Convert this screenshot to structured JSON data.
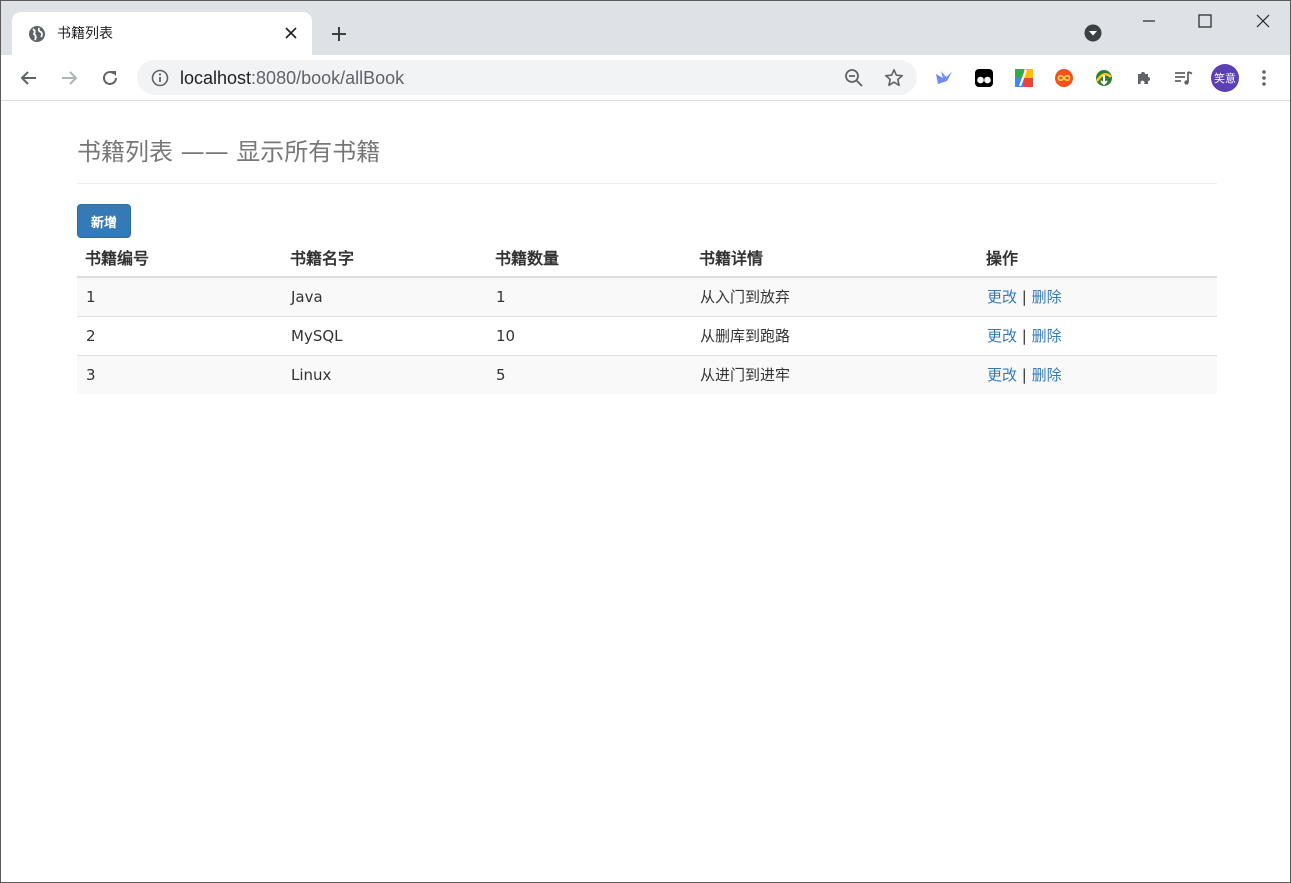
{
  "browser": {
    "tab_title": "书籍列表",
    "url_host": "localhost",
    "url_rest": ":8080/book/allBook",
    "avatar_text": "笑意",
    "icons": {
      "favicon": "globe-icon",
      "close": "close-icon",
      "new_tab": "plus-icon",
      "tab_search": "tab-search-icon",
      "back": "back-arrow-icon",
      "forward": "forward-arrow-icon",
      "reload": "reload-icon",
      "info": "info-icon",
      "zoom": "zoom-out-icon",
      "bookmark": "star-icon",
      "extensions": "puzzle-icon",
      "media": "media-control-icon",
      "menu": "kebab-menu-icon"
    }
  },
  "page": {
    "heading": "书籍列表 —— 显示所有书籍",
    "add_button": "新增",
    "table": {
      "headers": [
        "书籍编号",
        "书籍名字",
        "书籍数量",
        "书籍详情",
        "操作"
      ],
      "rows": [
        {
          "id": "1",
          "name": "Java",
          "count": "1",
          "detail": "从入门到放弃",
          "edit": "更改",
          "delete": "删除"
        },
        {
          "id": "2",
          "name": "MySQL",
          "count": "10",
          "detail": "从删库到跑路",
          "edit": "更改",
          "delete": "删除"
        },
        {
          "id": "3",
          "name": "Linux",
          "count": "5",
          "detail": "从进门到进牢",
          "edit": "更改",
          "delete": "删除"
        }
      ],
      "separator": "|"
    }
  },
  "colors": {
    "primary": "#337ab7",
    "tabstrip": "#dee1e6",
    "avatar": "#5b3fb5"
  }
}
